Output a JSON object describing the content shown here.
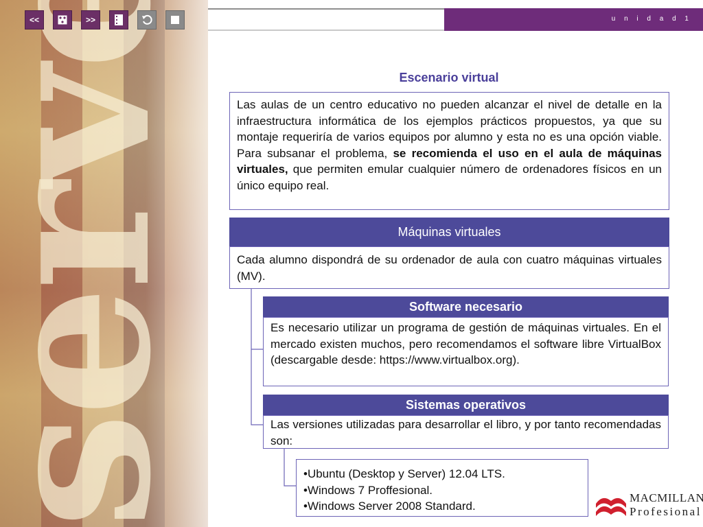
{
  "header": {
    "unit_label": "u n i d a d  1"
  },
  "nav": {
    "prev_label": "<<",
    "next_label": ">>"
  },
  "background": {
    "word": "server"
  },
  "title": "Escenario virtual",
  "intro": {
    "text_before": "Las aulas de un centro educativo no pueden alcanzar el nivel de detalle en la infraestructura informática de los ejemplos prácticos propuestos, ya que su montaje requeriría de varios equipos por alumno y esta no es una opción viable. Para subsanar el problema, ",
    "text_bold": "se recomienda el uso en el aula de máquinas virtuales,",
    "text_after": " que permiten emular cualquier número de ordenadores físicos en un único equipo real."
  },
  "maquinas": {
    "heading": "Máquinas virtuales",
    "text": "Cada alumno dispondrá de su ordenador de aula con cuatro máquinas virtuales (MV)."
  },
  "software": {
    "heading": "Software necesario",
    "text": "Es necesario utilizar un programa de gestión de máquinas virtuales. En el mercado existen muchos, pero recomendamos el software libre VirtualBox (descargable desde: https://www.virtualbox.org)."
  },
  "sistemas": {
    "heading": "Sistemas operativos",
    "text": "Las versiones utilizadas para desarrollar el libro, y por tanto recomendadas son:"
  },
  "os_list": [
    "•Ubuntu (Desktop y Server) 12.04 LTS.",
    "•Windows 7 Proffesional.",
    "•Windows Server 2008 Standard."
  ],
  "logo": {
    "line1": "MACMILLAN",
    "line2": "Profesional"
  },
  "colors": {
    "purple": "#6e2c7a",
    "header_blue": "#4d4a9a",
    "title": "#4a3f9a"
  }
}
